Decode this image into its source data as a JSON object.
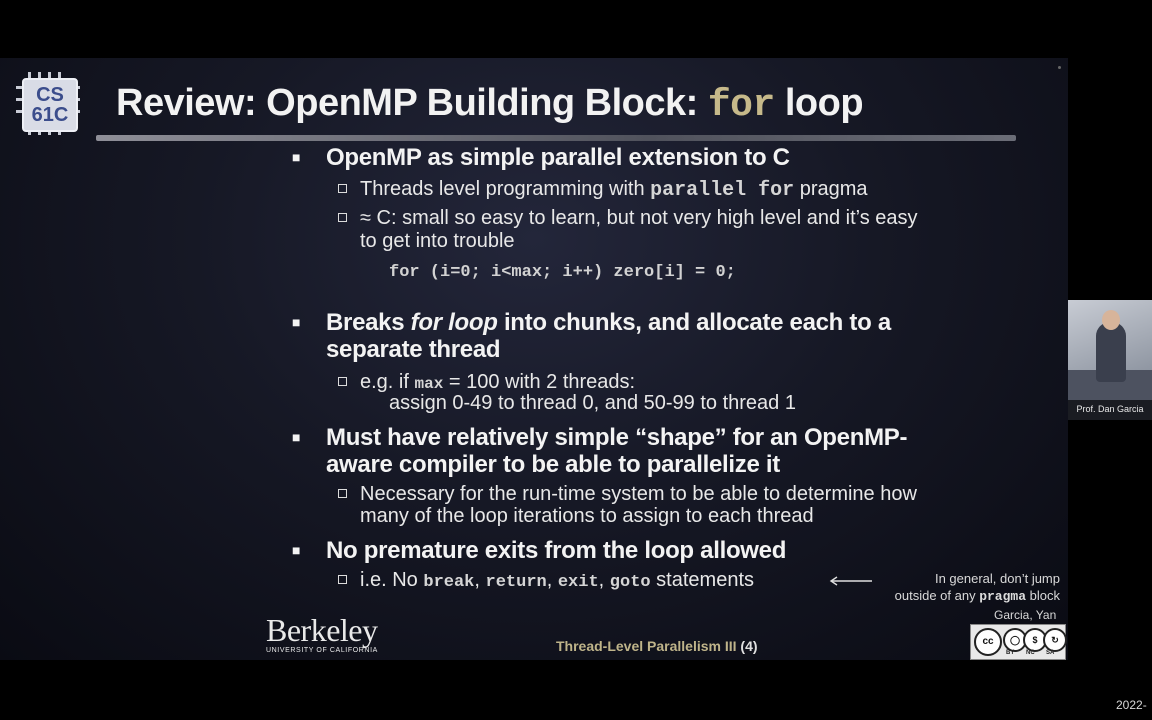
{
  "header": {
    "logo_line1": "CS",
    "logo_line2": "61C",
    "title_prefix": "Review: OpenMP Building Block:",
    "title_code": "for",
    "title_suffix": "loop"
  },
  "bullets": {
    "b1": {
      "text": "OpenMP as simple parallel extension to C",
      "sub1_prefix": "Threads level programming with",
      "sub1_code": "parallel for",
      "sub1_suffix": "pragma",
      "sub2_line1": "≈ C: small so easy to learn, but not very high level and it’s easy",
      "sub2_line2": "to get into trouble",
      "code": "for (i=0; i<max; i++) zero[i] = 0;"
    },
    "b2": {
      "text_pre": "Breaks",
      "text_em": "for loop",
      "text_post": "into chunks, and allocate each to a",
      "text_line2": "separate thread",
      "sub_prefix": "e.g. if",
      "sub_code": "max",
      "sub_suffix": "= 100 with 2 threads:",
      "sub_line2": "assign 0-49 to thread 0, and 50-99 to thread 1"
    },
    "b3": {
      "line1": "Must have relatively simple “shape” for an OpenMP-",
      "line2": "aware compiler to be able to parallelize it",
      "sub_line1": "Necessary for the run-time system to be able to determine how",
      "sub_line2": "many of the loop iterations to assign to each thread"
    },
    "b4": {
      "text": "No premature exits from the loop allowed",
      "sub_prefix": "i.e. No",
      "sub_codes": [
        "break",
        "return",
        "exit",
        "goto"
      ],
      "sub_suffix": "statements"
    }
  },
  "callout": {
    "line1": "In general, don’t jump",
    "line2_prefix": "outside of any",
    "line2_code": "pragma",
    "line2_suffix": "block"
  },
  "footer": {
    "berkeley": "Berkeley",
    "berkeley_sub": "UNIVERSITY OF CALIFORNIA",
    "lecture": "Thread-Level Parallelism III",
    "page": "(4)",
    "authors": "Garcia, Yan",
    "cc_labels": [
      "BY",
      "NC",
      "SA"
    ]
  },
  "webcam": {
    "caption": "Prof. Dan Garcia"
  },
  "datestamp": "2022-"
}
